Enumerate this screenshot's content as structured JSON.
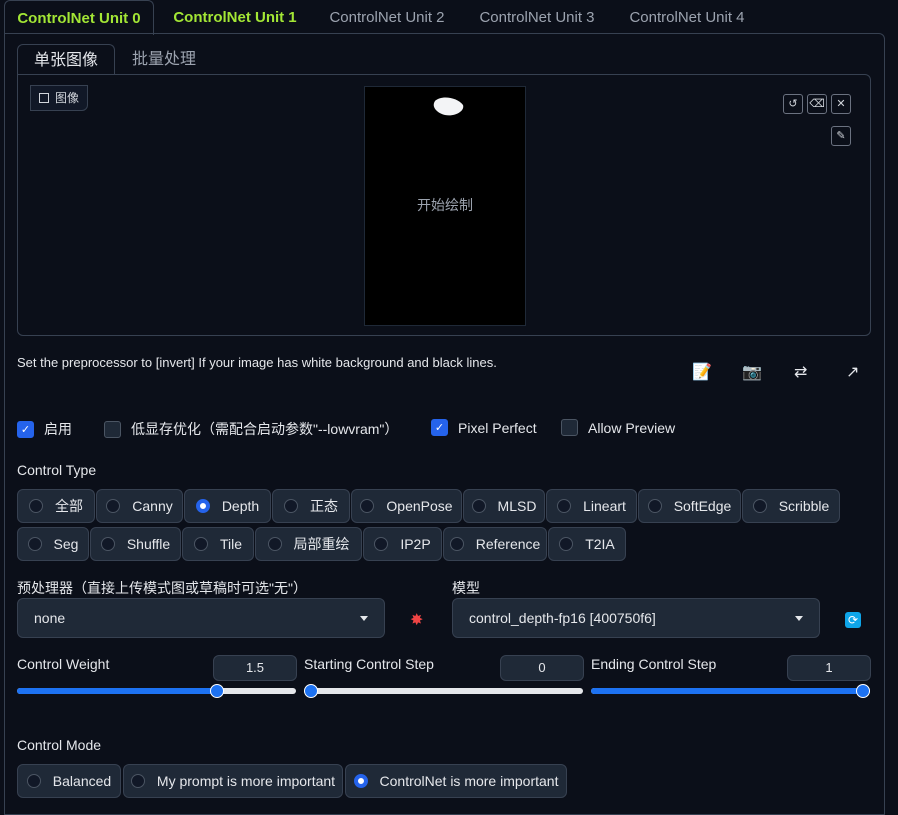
{
  "unit_tabs": [
    "ControlNet Unit 0",
    "ControlNet Unit 1",
    "ControlNet Unit 2",
    "ControlNet Unit 3",
    "ControlNet Unit 4"
  ],
  "sub_tabs": [
    "单张图像",
    "批量处理"
  ],
  "image_label": "图像",
  "canvas_text": "开始绘制",
  "hint": "Set the preprocessor to [invert] If your image has white background and black lines.",
  "checkboxes": [
    {
      "label": "启用",
      "checked": true
    },
    {
      "label": "低显存优化（需配合启动参数\"--lowvram\"）",
      "checked": false
    },
    {
      "label": "Pixel Perfect",
      "checked": true
    },
    {
      "label": "Allow Preview",
      "checked": false
    }
  ],
  "control_type_label": "Control Type",
  "control_types": [
    "全部",
    "Canny",
    "Depth",
    "正态",
    "OpenPose",
    "MLSD",
    "Lineart",
    "SoftEdge",
    "Scribble",
    "Seg",
    "Shuffle",
    "Tile",
    "局部重绘",
    "IP2P",
    "Reference",
    "T2IA"
  ],
  "control_type_selected": "Depth",
  "preprocessor": {
    "label": "预处理器（直接上传模式图或草稿时可选\"无\"）",
    "value": "none"
  },
  "model": {
    "label": "模型",
    "value": "control_depth-fp16 [400750f6]"
  },
  "sliders": [
    {
      "label": "Control Weight",
      "value": "1.5",
      "fraction": 0.73
    },
    {
      "label": "Starting Control Step",
      "value": "0",
      "fraction": 0.0
    },
    {
      "label": "Ending Control Step",
      "value": "1",
      "fraction": 1.0
    }
  ],
  "control_mode_label": "Control Mode",
  "control_modes": [
    "Balanced",
    "My prompt is more important",
    "ControlNet is more important"
  ],
  "control_mode_selected": "ControlNet is more important",
  "colors": {
    "accent": "#2563eb",
    "tab_active": "#a3e635",
    "background": "#0b0f19"
  }
}
